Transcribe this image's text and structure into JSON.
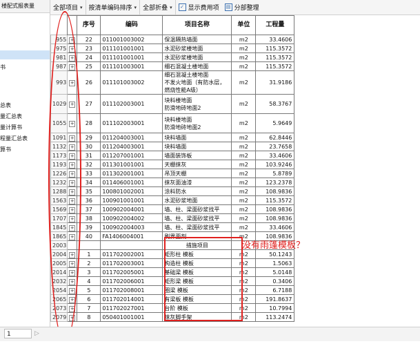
{
  "sidebar": {
    "header": "楼配式报表量",
    "items": [
      {
        "label": "书",
        "selected": false
      },
      {
        "label": "总表",
        "selected": false
      },
      {
        "label": "量汇总表",
        "selected": false
      },
      {
        "label": "量计算书",
        "selected": false
      },
      {
        "label": "程量汇总表",
        "selected": false
      },
      {
        "label": "算书",
        "selected": false
      }
    ]
  },
  "toolbar": {
    "all_items": "全部项目",
    "sort": "按清单编码排序",
    "fold": "全部折叠",
    "show_cost": "显示费用项",
    "split": "分部整理"
  },
  "table": {
    "headers": {
      "seq": "序号",
      "code": "编码",
      "name": "项目名称",
      "unit": "单位",
      "qty": "工程量"
    },
    "rows": [
      {
        "rn": "955",
        "seq": "22",
        "code": "011001003002",
        "name": "保温隔热墙面",
        "unit": "m2",
        "qty": "33.4606"
      },
      {
        "rn": "975",
        "seq": "23",
        "code": "011101001001",
        "name": "水泥砂浆楼地面",
        "unit": "m2",
        "qty": "115.3572"
      },
      {
        "rn": "981",
        "seq": "24",
        "code": "011101001001",
        "name": "水泥砂浆楼地面",
        "unit": "m2",
        "qty": "115.3572"
      },
      {
        "rn": "987",
        "seq": "25",
        "code": "011101003001",
        "name": "细石混凝土楼地面",
        "unit": "m2",
        "qty": "115.3572"
      },
      {
        "rn": "993",
        "seq": "26",
        "code": "011101003002",
        "name": "细石混凝土楼地面\n不发火地面（有防水层，燃烧性能A级）",
        "unit": "m2",
        "qty": "31.9186"
      },
      {
        "rn": "1029",
        "seq": "27",
        "code": "011102003001",
        "name": "块料楼地面\n防滑地砖地面2",
        "unit": "m2",
        "qty": "58.3767"
      },
      {
        "rn": "1055",
        "seq": "28",
        "code": "011102003001",
        "name": "块料楼地面\n防滑地砖地面2",
        "unit": "m2",
        "qty": "5.9649"
      },
      {
        "rn": "1091",
        "seq": "29",
        "code": "011204003001",
        "name": "块料墙面",
        "unit": "m2",
        "qty": "62.8446"
      },
      {
        "rn": "1132",
        "seq": "30",
        "code": "011204003001",
        "name": "块料墙面",
        "unit": "m2",
        "qty": "23.7658"
      },
      {
        "rn": "1173",
        "seq": "31",
        "code": "011207001001",
        "name": "墙面装饰板",
        "unit": "m2",
        "qty": "33.4606"
      },
      {
        "rn": "1193",
        "seq": "32",
        "code": "011301001001",
        "name": "天棚抹灰",
        "unit": "m2",
        "qty": "103.9246"
      },
      {
        "rn": "1226",
        "seq": "33",
        "code": "011302001001",
        "name": "吊顶天棚",
        "unit": "m2",
        "qty": "5.8789"
      },
      {
        "rn": "1232",
        "seq": "34",
        "code": "011406001001",
        "name": "抹灰面油漆",
        "unit": "m2",
        "qty": "123.2378"
      },
      {
        "rn": "1288",
        "seq": "35",
        "code": "100801002001",
        "name": "涂料防水",
        "unit": "m2",
        "qty": "108.9836"
      },
      {
        "rn": "1563",
        "seq": "36",
        "code": "100901001001",
        "name": "水泥砂浆地面",
        "unit": "m2",
        "qty": "115.3572"
      },
      {
        "rn": "1569",
        "seq": "37",
        "code": "100902004001",
        "name": "墙、柱、梁面砂浆找平",
        "unit": "m2",
        "qty": "108.9836"
      },
      {
        "rn": "1707",
        "seq": "38",
        "code": "100902004002",
        "name": "墙、柱、梁面砂浆找平",
        "unit": "m2",
        "qty": "108.9836"
      },
      {
        "rn": "1845",
        "seq": "39",
        "code": "100902004003",
        "name": "墙、柱、梁面砂浆找平",
        "unit": "m2",
        "qty": "33.4606"
      },
      {
        "rn": "1865",
        "seq": "40",
        "code": "FA1406004001",
        "name": "刷界面剂",
        "unit": "m2",
        "qty": "108.9836"
      },
      {
        "rn": "2003",
        "seq": "",
        "code": "",
        "name": "措施项目",
        "unit": "",
        "qty": "",
        "category": true
      },
      {
        "rn": "2004",
        "seq": "1",
        "code": "011702002001",
        "name": "矩形柱 模板",
        "unit": "m2",
        "qty": "50.1243"
      },
      {
        "rn": "2005",
        "seq": "2",
        "code": "011702003001",
        "name": "构造柱 模板",
        "unit": "m2",
        "qty": "1.5063"
      },
      {
        "rn": "2014",
        "seq": "3",
        "code": "011702005001",
        "name": "基础梁 模板",
        "unit": "m2",
        "qty": "5.0148"
      },
      {
        "rn": "2032",
        "seq": "4",
        "code": "011702006001",
        "name": "矩形梁 模板",
        "unit": "m2",
        "qty": "0.3406"
      },
      {
        "rn": "2054",
        "seq": "5",
        "code": "011702008001",
        "name": "圈梁 模板",
        "unit": "m2",
        "qty": "6.7188"
      },
      {
        "rn": "2065",
        "seq": "6",
        "code": "011702014001",
        "name": "有梁板 模板",
        "unit": "m2",
        "qty": "191.8637"
      },
      {
        "rn": "2073",
        "seq": "7",
        "code": "011702027001",
        "name": "台阶 模板",
        "unit": "m2",
        "qty": "10.7994"
      },
      {
        "rn": "2079",
        "seq": "8",
        "code": "050401001001",
        "name": "抹灰脚手架",
        "unit": "m2",
        "qty": "113.2474"
      }
    ]
  },
  "annotation": {
    "text": "没有雨篷模板？",
    "color": "#e0201e"
  },
  "bottom": {
    "page": "1"
  }
}
